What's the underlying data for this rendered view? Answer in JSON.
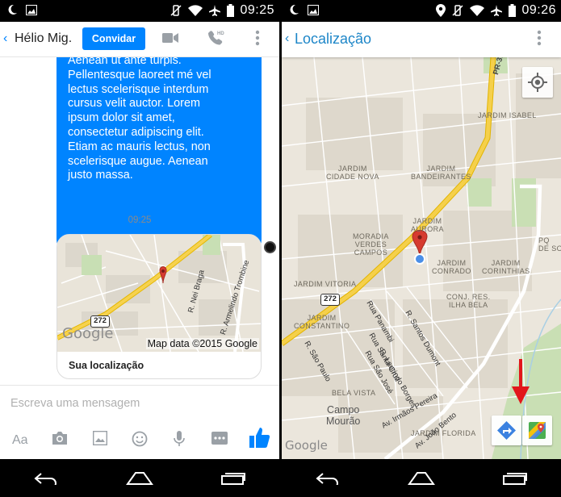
{
  "status_left": {
    "time": "09:25"
  },
  "status_right": {
    "time": "09:26"
  },
  "messenger": {
    "contact_name": "Hélio Mig...",
    "invite_label": "Convidar",
    "message_lines": [
      "Aenean ut ante turpis.",
      "Pellentesque laoreet mé vel",
      "lectus scelerisque interdum",
      "cursus velit auctor. Lorem",
      "ipsum dolor sit amet,",
      "consectetur adipiscing elit.",
      "Etiam ac mauris lectus, non",
      "scelerisque augue. Aenean",
      "justo massa."
    ],
    "message_time": "09:25",
    "location_card": {
      "map_attribution": "Map data ©2015 Google",
      "label": "Sua localização",
      "road_shield": "272",
      "streets": [
        "R. Nei Braga",
        "R. Armelindo Trombine"
      ],
      "watermark": "Google"
    },
    "compose_placeholder": "Escreva uma mensagem",
    "tools": [
      "Aa",
      "camera-icon",
      "gallery-icon",
      "emoji-icon",
      "microphone-icon",
      "more-icon",
      "like-icon"
    ],
    "accent_color": "#0084ff"
  },
  "map_app": {
    "title": "Localização",
    "road_label": "PR-317",
    "road_shield": "272",
    "watermark": "Google",
    "neighborhoods": [
      "JARDIM ISABEL",
      "JARDIM\nCIDADE NOVA",
      "JARDIM\nBANDEIRANTES",
      "MORADIA\nVERDES\nCAMPOS",
      "JARDIM\nAURORA",
      "JARDIM\nCONRADO",
      "JARDIM\nCORINTHIAS",
      "JARDIM VITORIA",
      "JARDIM\nCONSTANTINO",
      "CONJ. RES.\nILHA BELA",
      "BELA VISTA",
      "JARDIM FLORIDA",
      "PQ\nDE SOU"
    ],
    "streets": [
      "R. Laurindo Borges",
      "Rua Panambi",
      "R. Santos Dumont",
      "Rua Santa Cruz",
      "Rua São José",
      "R. São Paulo",
      "Av. Irmãos Pereira",
      "Av. João Bento"
    ],
    "city_label": "Campo\nMourão",
    "accent_color": "#1d86c8"
  }
}
